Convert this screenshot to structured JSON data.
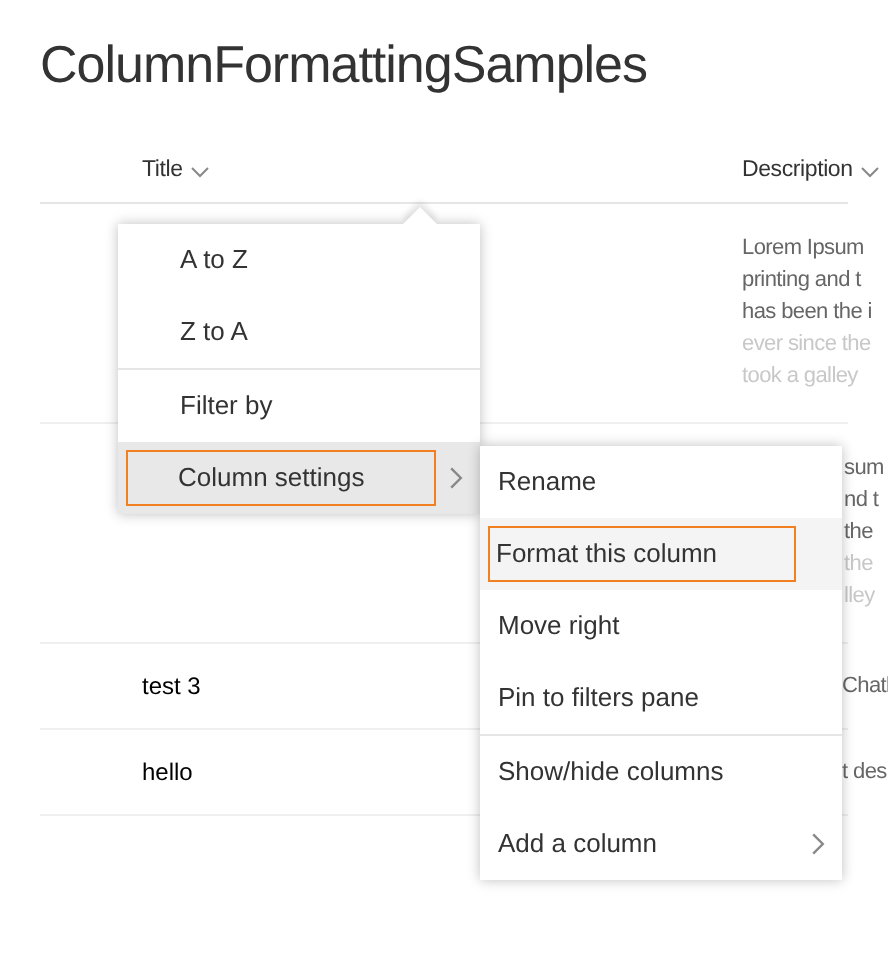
{
  "page_title": "ColumnFormattingSamples",
  "columns": [
    {
      "label": "Title"
    },
    {
      "label": "Description"
    }
  ],
  "rows": [
    {
      "kind": "tall",
      "title": "",
      "description": [
        {
          "text": "Lorem Ipsum",
          "faded": false
        },
        {
          "text": "printing and t",
          "faded": false
        },
        {
          "text": "has been the i",
          "faded": false
        },
        {
          "text": "ever since the",
          "faded": true
        },
        {
          "text": "took a galley",
          "faded": true
        }
      ]
    },
    {
      "kind": "tall",
      "title": "",
      "description": [
        {
          "text": "sum",
          "faded": false
        },
        {
          "text": "nd t",
          "faded": false
        },
        {
          "text": "the",
          "faded": false
        },
        {
          "text": "the",
          "faded": true
        },
        {
          "text": "lley",
          "faded": true
        }
      ]
    },
    {
      "kind": "short",
      "title": "test 3",
      "description": [
        {
          "text": "Chatl"
        }
      ]
    },
    {
      "kind": "short",
      "title": "hello",
      "description": [
        {
          "text": "t des"
        }
      ]
    }
  ],
  "column_menu": {
    "items": [
      {
        "label": "A to Z",
        "selected": false,
        "submenu": false
      },
      {
        "label": "Z to A",
        "selected": false,
        "submenu": false,
        "divider_after": true
      },
      {
        "label": "Filter by",
        "selected": false,
        "submenu": false
      },
      {
        "label": "Column settings",
        "selected": true,
        "submenu": true
      }
    ]
  },
  "settings_submenu": {
    "items": [
      {
        "label": "Rename",
        "selected": false,
        "submenu": false
      },
      {
        "label": "Format this column",
        "selected": true,
        "submenu": false
      },
      {
        "label": "Move right",
        "selected": false,
        "submenu": false
      },
      {
        "label": "Pin to filters pane",
        "selected": false,
        "submenu": false,
        "divider_after": true
      },
      {
        "label": "Show/hide columns",
        "selected": false,
        "submenu": false
      },
      {
        "label": "Add a column",
        "selected": false,
        "submenu": true
      }
    ]
  }
}
